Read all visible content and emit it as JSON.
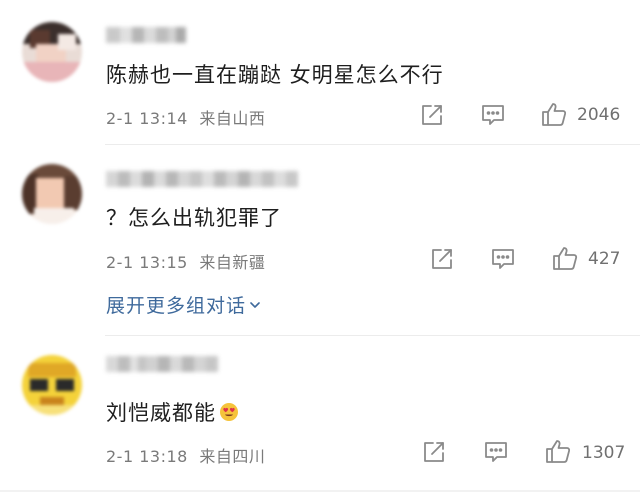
{
  "comments": [
    {
      "text": "陈赫也一直在蹦跶 女明星怎么不行",
      "time": "2-1 13:14",
      "location": "来自山西",
      "likes": "2046"
    },
    {
      "text": "？怎么出轨犯罪了",
      "time": "2-1 13:15",
      "location": "来自新疆",
      "likes": "427",
      "expand_label": "展开更多组对话"
    },
    {
      "text": "刘恺威都能",
      "emoji": "heart-eyes-emoji",
      "time": "2-1 13:18",
      "location": "来自四川",
      "likes": "1307"
    }
  ],
  "icons": {
    "share": "share-icon",
    "comment": "comment-icon",
    "like": "thumbs-up-icon",
    "expand": "chevron-down-icon"
  },
  "colors": {
    "text": "#1e1e1e",
    "meta": "#7a7a7a",
    "link": "#3f6a9c",
    "icon": "#8a8a8a"
  }
}
